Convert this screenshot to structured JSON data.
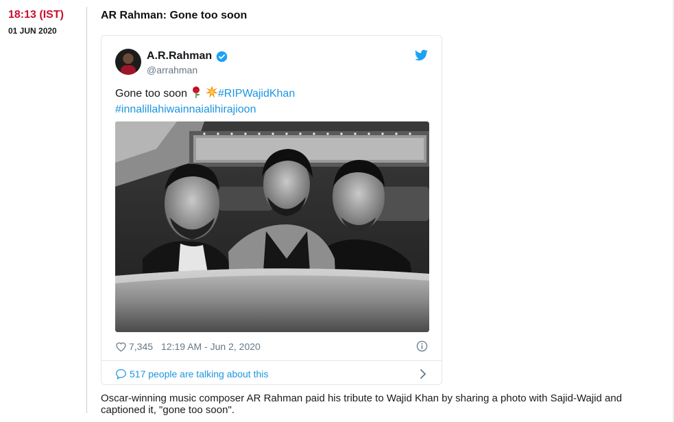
{
  "live_entry": {
    "time": "18:13 (IST)",
    "date": "01 JUN 2020",
    "headline": "AR Rahman: Gone too soon"
  },
  "tweet": {
    "author_name": "A.R.Rahman",
    "author_handle": "@arrahman",
    "text_plain": "Gone too soon",
    "hashtag_1": "#RIPWajidKhan",
    "hashtag_2": "#innalillahiwainnaialihirajioon",
    "like_count": "7,345",
    "timestamp": "12:19 AM - Jun 2, 2020",
    "talking_text": "517 people are talking about this",
    "icons": [
      "verified-icon",
      "twitter-bird-icon",
      "heart-icon",
      "info-icon",
      "bubble-icon",
      "chevron-right-icon",
      "rose-emoji",
      "collision-emoji"
    ],
    "colors": {
      "link": "#1b95e0",
      "verified": "#1da1f2",
      "meta": "#657786"
    }
  },
  "caption": "Oscar-winning music composer AR Rahman paid his tribute to Wajid Khan by sharing a photo with Sajid-Wajid and captioned it, \"gone too soon\".",
  "colors": {
    "time": "#c8102e"
  }
}
